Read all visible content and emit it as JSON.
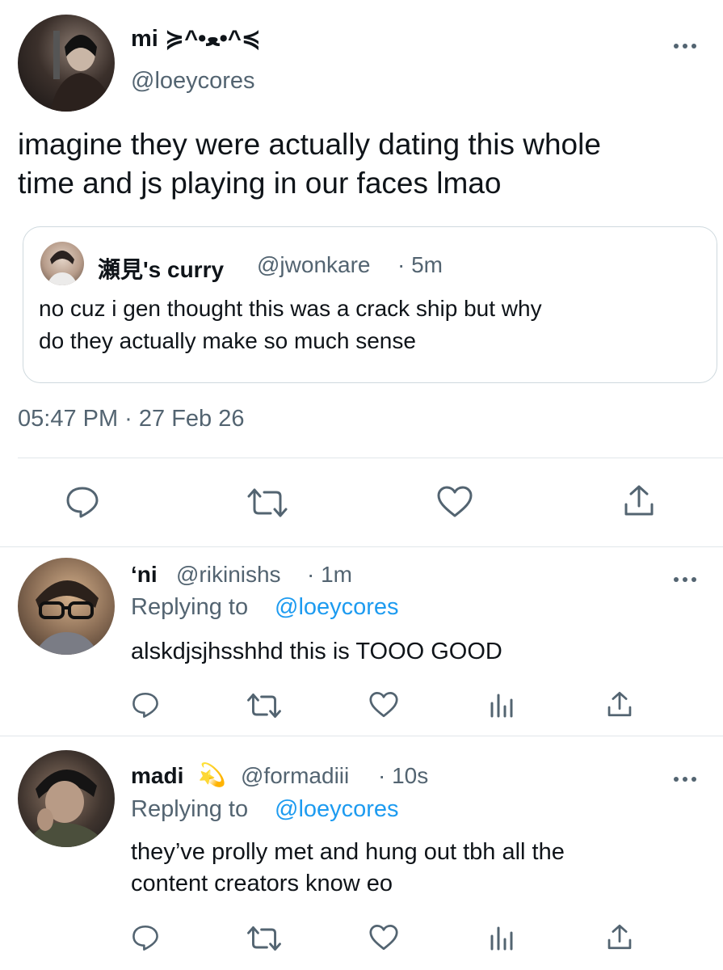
{
  "main_tweet": {
    "display_name": "mi ≽^•ﻌ•^≼",
    "handle": "@loeycores",
    "text_line1": "imagine they were actually dating this whole",
    "text_line2": "time and js playing in our faces lmao",
    "quoted": {
      "display_name": "瀬見's curry",
      "handle": "@jwonkare",
      "time": "· 5m",
      "text_line1": "no cuz i gen thought this was a crack ship but why",
      "text_line2": "do they actually make so much sense"
    },
    "timestamp": "05:47 PM · 27 Feb 26"
  },
  "replies": [
    {
      "display_name": "‘ni",
      "handle": "@rikinishs",
      "time": "· 1m",
      "replying_prefix": "Replying to",
      "replying_handle": "@loeycores",
      "text_line1": "alskdjsjhsshhd this is TOOO GOOD",
      "text_line2": ""
    },
    {
      "display_name": "madi",
      "emoji": "💫",
      "handle": "@formadiii",
      "time": "· 10s",
      "replying_prefix": "Replying to",
      "replying_handle": "@loeycores",
      "text_line1": "they’ve prolly met and hung out tbh all the",
      "text_line2": "content creators know eo"
    }
  ],
  "icons": [
    "reply-icon",
    "retweet-icon",
    "like-icon",
    "share-icon",
    "views-icon",
    "more-icon"
  ],
  "colors": {
    "text": "#0f1419",
    "muted": "#536471",
    "link": "#1d9bf0",
    "divider": "#e1e6ea"
  }
}
